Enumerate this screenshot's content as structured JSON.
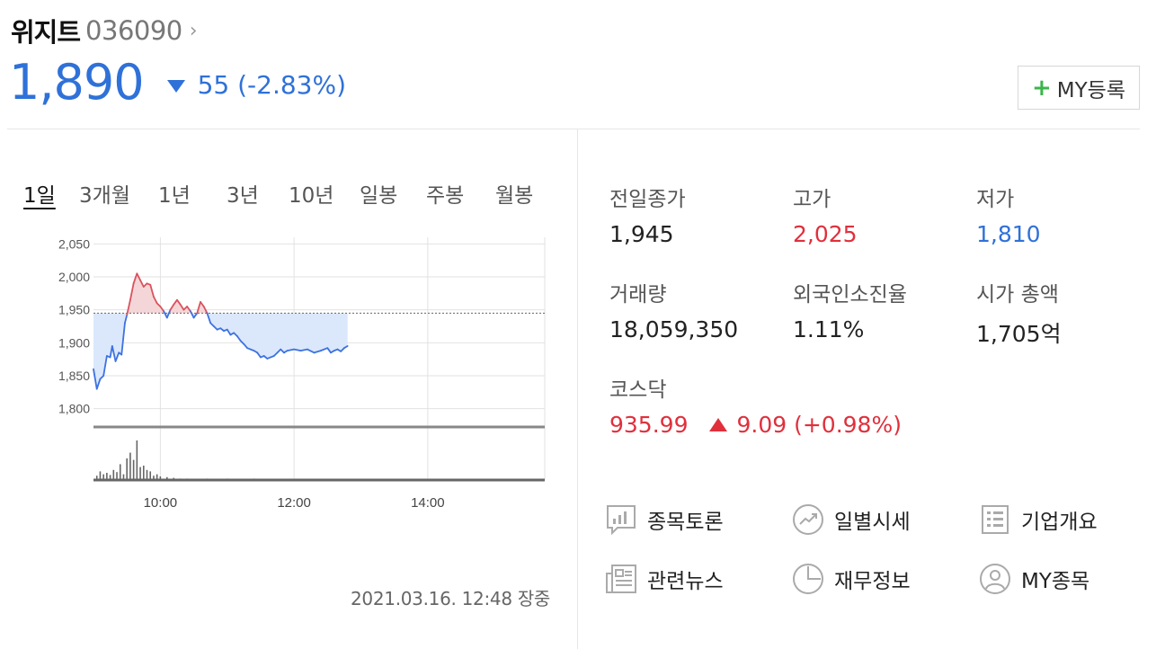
{
  "stock": {
    "name": "위지트",
    "code": "036090",
    "price": "1,890",
    "change": "55 (-2.83%)",
    "my_button_label": "MY등록"
  },
  "period_tabs": [
    "1일",
    "3개월",
    "1년",
    "3년",
    "10년",
    "일봉",
    "주봉",
    "월봉"
  ],
  "chart_timestamp": "2021.03.16. 12:48 장중",
  "stats": {
    "prev_close": {
      "label": "전일종가",
      "value": "1,945"
    },
    "high": {
      "label": "고가",
      "value": "2,025"
    },
    "low": {
      "label": "저가",
      "value": "1,810"
    },
    "volume": {
      "label": "거래량",
      "value": "18,059,350"
    },
    "foreign_rate": {
      "label": "외국인소진율",
      "value": "1.11%"
    },
    "market_cap": {
      "label": "시가 총액",
      "value": "1,705억"
    },
    "kosdaq": {
      "label": "코스닥",
      "value": "935.99",
      "change": "9.09 (+0.98%)"
    }
  },
  "links": [
    {
      "label": "종목토론",
      "icon": "discussion-chart-icon"
    },
    {
      "label": "일별시세",
      "icon": "trend-circle-icon"
    },
    {
      "label": "기업개요",
      "icon": "list-doc-icon"
    },
    {
      "label": "관련뉴스",
      "icon": "newspaper-icon"
    },
    {
      "label": "재무정보",
      "icon": "pie-chart-icon"
    },
    {
      "label": "MY종목",
      "icon": "user-circle-icon"
    }
  ],
  "colors": {
    "down": "#2f71d8",
    "up": "#e0303c",
    "add": "#3bb54a"
  },
  "chart_data": {
    "type": "line",
    "ylim": [
      1775,
      2060
    ],
    "yticks": [
      "2,050",
      "2,000",
      "1,950",
      "1,900",
      "1,850",
      "1,800"
    ],
    "ytick_values": [
      2050,
      2000,
      1950,
      1900,
      1850,
      1800
    ],
    "xticks": [
      "10:00",
      "12:00",
      "14:00"
    ],
    "xtick_values": [
      10,
      12,
      14
    ],
    "xlim": [
      9.0,
      15.75
    ],
    "baseline": 1945,
    "series": [
      {
        "points": [
          [
            9.0,
            1860
          ],
          [
            9.05,
            1830
          ],
          [
            9.1,
            1845
          ],
          [
            9.15,
            1850
          ],
          [
            9.2,
            1880
          ],
          [
            9.25,
            1878
          ],
          [
            9.28,
            1895
          ],
          [
            9.33,
            1872
          ],
          [
            9.38,
            1885
          ],
          [
            9.42,
            1882
          ],
          [
            9.47,
            1930
          ],
          [
            9.5,
            1942
          ],
          [
            9.55,
            1965
          ],
          [
            9.6,
            1990
          ],
          [
            9.65,
            2005
          ],
          [
            9.7,
            1995
          ],
          [
            9.75,
            1985
          ],
          [
            9.8,
            1990
          ],
          [
            9.85,
            1988
          ],
          [
            9.9,
            1970
          ],
          [
            9.95,
            1960
          ],
          [
            10.0,
            1955
          ],
          [
            10.05,
            1948
          ],
          [
            10.1,
            1938
          ],
          [
            10.15,
            1950
          ],
          [
            10.2,
            1958
          ],
          [
            10.25,
            1965
          ],
          [
            10.3,
            1958
          ],
          [
            10.35,
            1950
          ],
          [
            10.4,
            1955
          ],
          [
            10.45,
            1948
          ],
          [
            10.5,
            1938
          ],
          [
            10.55,
            1945
          ],
          [
            10.6,
            1962
          ],
          [
            10.65,
            1955
          ],
          [
            10.7,
            1945
          ],
          [
            10.75,
            1930
          ],
          [
            10.8,
            1925
          ],
          [
            10.85,
            1920
          ],
          [
            10.9,
            1922
          ],
          [
            10.95,
            1918
          ],
          [
            11.0,
            1920
          ],
          [
            11.05,
            1912
          ],
          [
            11.1,
            1915
          ],
          [
            11.15,
            1910
          ],
          [
            11.2,
            1903
          ],
          [
            11.25,
            1898
          ],
          [
            11.3,
            1892
          ],
          [
            11.35,
            1890
          ],
          [
            11.4,
            1888
          ],
          [
            11.45,
            1885
          ],
          [
            11.5,
            1878
          ],
          [
            11.55,
            1880
          ],
          [
            11.6,
            1876
          ],
          [
            11.65,
            1878
          ],
          [
            11.7,
            1880
          ],
          [
            11.75,
            1885
          ],
          [
            11.8,
            1890
          ],
          [
            11.85,
            1885
          ],
          [
            11.9,
            1888
          ],
          [
            12.0,
            1890
          ],
          [
            12.1,
            1888
          ],
          [
            12.2,
            1890
          ],
          [
            12.3,
            1885
          ],
          [
            12.4,
            1888
          ],
          [
            12.5,
            1892
          ],
          [
            12.55,
            1885
          ],
          [
            12.6,
            1888
          ],
          [
            12.65,
            1890
          ],
          [
            12.7,
            1887
          ],
          [
            12.75,
            1892
          ],
          [
            12.8,
            1895
          ]
        ]
      }
    ],
    "volume": {
      "bars": [
        [
          9.05,
          6
        ],
        [
          9.1,
          12
        ],
        [
          9.15,
          8
        ],
        [
          9.2,
          10
        ],
        [
          9.25,
          7
        ],
        [
          9.3,
          14
        ],
        [
          9.35,
          11
        ],
        [
          9.4,
          22
        ],
        [
          9.45,
          8
        ],
        [
          9.5,
          30
        ],
        [
          9.55,
          38
        ],
        [
          9.6,
          28
        ],
        [
          9.65,
          55
        ],
        [
          9.7,
          18
        ],
        [
          9.75,
          20
        ],
        [
          9.8,
          14
        ],
        [
          9.85,
          12
        ],
        [
          9.9,
          6
        ],
        [
          9.95,
          8
        ],
        [
          10.0,
          5
        ],
        [
          10.1,
          4
        ],
        [
          10.2,
          3
        ],
        [
          10.3,
          2
        ],
        [
          10.4,
          2
        ],
        [
          10.5,
          1
        ],
        [
          10.6,
          1
        ],
        [
          10.7,
          2
        ],
        [
          10.8,
          1
        ],
        [
          11.0,
          2
        ],
        [
          11.2,
          1
        ],
        [
          11.4,
          2
        ],
        [
          11.6,
          1
        ],
        [
          11.8,
          1
        ],
        [
          12.0,
          1
        ]
      ],
      "ylim": [
        0,
        60
      ]
    }
  }
}
